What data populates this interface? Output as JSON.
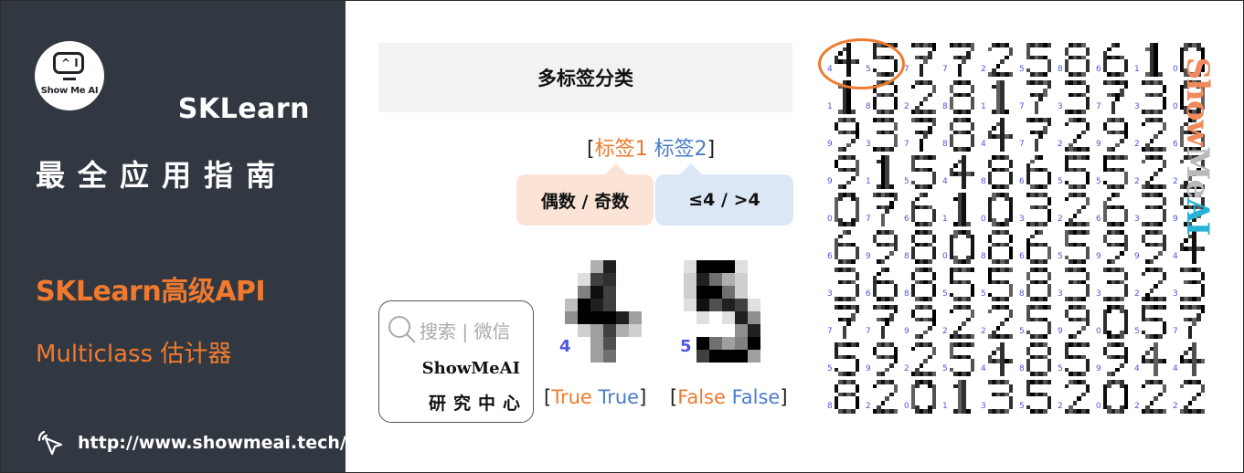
{
  "sidebar": {
    "logo_text": "Show Me AI",
    "logo_face": "^ I",
    "title": "SKLearn",
    "subtitle": "最全应用指南",
    "section": "SKLearn高级API",
    "topic": "Multiclass 估计器",
    "link": "http://www.showmeai.tech/",
    "link_icon": "cursor-click-icon"
  },
  "diagram": {
    "title": "多标签分类",
    "labels": {
      "open": "[",
      "label1": "标签1",
      "label2": "标签2",
      "close": "]"
    },
    "bubbles": [
      {
        "text": "偶数 / 奇数",
        "color": "#fbe3d6"
      },
      {
        "text": "≤4 / >4",
        "color": "#dbe7f5"
      }
    ],
    "examples": [
      {
        "digit": "4",
        "result_open": "[",
        "result1": "True",
        "result2": "True",
        "result_close": "]",
        "pixels": [
          [
            0,
            0,
            0,
            5,
            14,
            0,
            0,
            0
          ],
          [
            0,
            0,
            2,
            12,
            13,
            0,
            0,
            0
          ],
          [
            0,
            0,
            8,
            15,
            12,
            0,
            0,
            0
          ],
          [
            0,
            4,
            16,
            14,
            12,
            0,
            0,
            0
          ],
          [
            0,
            7,
            16,
            16,
            16,
            14,
            6,
            0
          ],
          [
            0,
            0,
            3,
            6,
            12,
            5,
            3,
            0
          ],
          [
            0,
            0,
            0,
            6,
            11,
            0,
            0,
            0
          ],
          [
            0,
            0,
            0,
            6,
            9,
            0,
            0,
            0
          ]
        ]
      },
      {
        "digit": "5",
        "result_open": "[",
        "result1": "False",
        "result2": "False",
        "result_close": "]",
        "pixels": [
          [
            0,
            2,
            16,
            16,
            16,
            2,
            0,
            0
          ],
          [
            0,
            3,
            14,
            9,
            5,
            3,
            0,
            0
          ],
          [
            0,
            3,
            16,
            16,
            9,
            3,
            0,
            0
          ],
          [
            0,
            2,
            15,
            11,
            14,
            12,
            2,
            0
          ],
          [
            0,
            0,
            2,
            0,
            2,
            14,
            7,
            0
          ],
          [
            0,
            0,
            0,
            0,
            0,
            7,
            14,
            0
          ],
          [
            0,
            0,
            16,
            9,
            6,
            8,
            16,
            0
          ],
          [
            0,
            0,
            12,
            16,
            16,
            16,
            6,
            0
          ]
        ]
      }
    ]
  },
  "wechat_card": {
    "search_icon": "search-icon",
    "search_text": "搜索 | 微信",
    "brand": "ShowMeAI",
    "center": "研究中心"
  },
  "digit_grid": {
    "rows": [
      [
        "4",
        "5",
        "7",
        "7",
        "2",
        "5",
        "8",
        "6",
        "1",
        "0"
      ],
      [
        "1",
        "8",
        "2",
        "8",
        "1",
        "7",
        "3",
        "7",
        "3",
        "0"
      ],
      [
        "9",
        "3",
        "7",
        "8",
        "4",
        "7",
        "2",
        "9",
        "2",
        "6"
      ],
      [
        "9",
        "1",
        "5",
        "4",
        "8",
        "6",
        "5",
        "5",
        "2",
        "2"
      ],
      [
        "0",
        "7",
        "6",
        "1",
        "0",
        "3",
        "2",
        "6",
        "3",
        "9"
      ],
      [
        "6",
        "9",
        "8",
        "0",
        "8",
        "6",
        "5",
        "9",
        "9",
        "4"
      ],
      [
        "3",
        "6",
        "8",
        "5",
        "5",
        "8",
        "3",
        "3",
        "2",
        "3"
      ],
      [
        "7",
        "7",
        "9",
        "2",
        "2",
        "5",
        "9",
        "0",
        "5",
        "7"
      ],
      [
        "5",
        "9",
        "2",
        "5",
        "4",
        "8",
        "5",
        "9",
        "4",
        "4"
      ],
      [
        "8",
        "2",
        "0",
        "1",
        "3",
        "5",
        "2",
        "0",
        "2",
        "2"
      ]
    ],
    "highlighted": [
      "4",
      "5"
    ],
    "highlight_color": "#ef7a2f",
    "label_color": "#4e56e0"
  },
  "watermark": {
    "part1": "Show",
    "part2": "Me",
    "part3": "AI"
  },
  "colors": {
    "sidebar_bg": "#323842",
    "accent_orange": "#ef7a2f",
    "accent_blue": "#4a7cc7"
  }
}
